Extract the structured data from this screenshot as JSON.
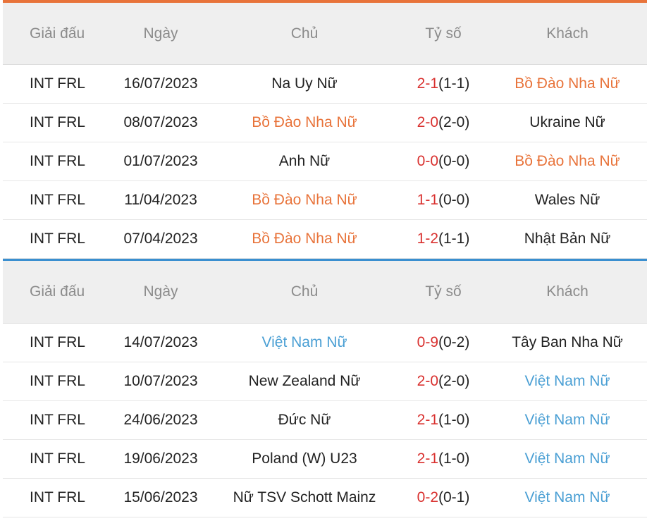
{
  "colors": {
    "accent_orange": "#e8733a",
    "accent_blue": "#3a8fd0",
    "highlight_portugal": "#e8733a",
    "highlight_vietnam": "#4a9fd4",
    "score_red": "#d9312f"
  },
  "portugal_table": {
    "headers": {
      "league": "Giải đấu",
      "date": "Ngày",
      "home": "Chủ",
      "score": "Tỷ số",
      "away": "Khách"
    },
    "rows": [
      {
        "league": "INT FRL",
        "date": "16/07/2023",
        "home": "Na Uy Nữ",
        "ft": "2-1",
        "ht": "(1-1)",
        "away": "Bồ Đào Nha Nữ",
        "highlight": "away"
      },
      {
        "league": "INT FRL",
        "date": "08/07/2023",
        "home": "Bồ Đào Nha Nữ",
        "ft": "2-0",
        "ht": "(2-0)",
        "away": "Ukraine Nữ",
        "highlight": "home"
      },
      {
        "league": "INT FRL",
        "date": "01/07/2023",
        "home": "Anh Nữ",
        "ft": "0-0",
        "ht": "(0-0)",
        "away": "Bồ Đào Nha Nữ",
        "highlight": "away"
      },
      {
        "league": "INT FRL",
        "date": "11/04/2023",
        "home": "Bồ Đào Nha Nữ",
        "ft": "1-1",
        "ht": "(0-0)",
        "away": "Wales Nữ",
        "highlight": "home"
      },
      {
        "league": "INT FRL",
        "date": "07/04/2023",
        "home": "Bồ Đào Nha Nữ",
        "ft": "1-2",
        "ht": "(1-1)",
        "away": "Nhật Bản Nữ",
        "highlight": "home"
      }
    ]
  },
  "vietnam_table": {
    "headers": {
      "league": "Giải đấu",
      "date": "Ngày",
      "home": "Chủ",
      "score": "Tỷ số",
      "away": "Khách"
    },
    "rows": [
      {
        "league": "INT FRL",
        "date": "14/07/2023",
        "home": "Việt Nam Nữ",
        "ft": "0-9",
        "ht": "(0-2)",
        "away": "Tây Ban Nha Nữ",
        "highlight": "home"
      },
      {
        "league": "INT FRL",
        "date": "10/07/2023",
        "home": "New Zealand Nữ",
        "ft": "2-0",
        "ht": "(2-0)",
        "away": "Việt Nam Nữ",
        "highlight": "away"
      },
      {
        "league": "INT FRL",
        "date": "24/06/2023",
        "home": "Đức Nữ",
        "ft": "2-1",
        "ht": "(1-0)",
        "away": "Việt Nam Nữ",
        "highlight": "away"
      },
      {
        "league": "INT FRL",
        "date": "19/06/2023",
        "home": "Poland (W) U23",
        "ft": "2-1",
        "ht": "(1-0)",
        "away": "Việt Nam Nữ",
        "highlight": "away"
      },
      {
        "league": "INT FRL",
        "date": "15/06/2023",
        "home": "Nữ TSV Schott Mainz",
        "ft": "0-2",
        "ht": "(0-1)",
        "away": "Việt Nam Nữ",
        "highlight": "away"
      }
    ]
  }
}
